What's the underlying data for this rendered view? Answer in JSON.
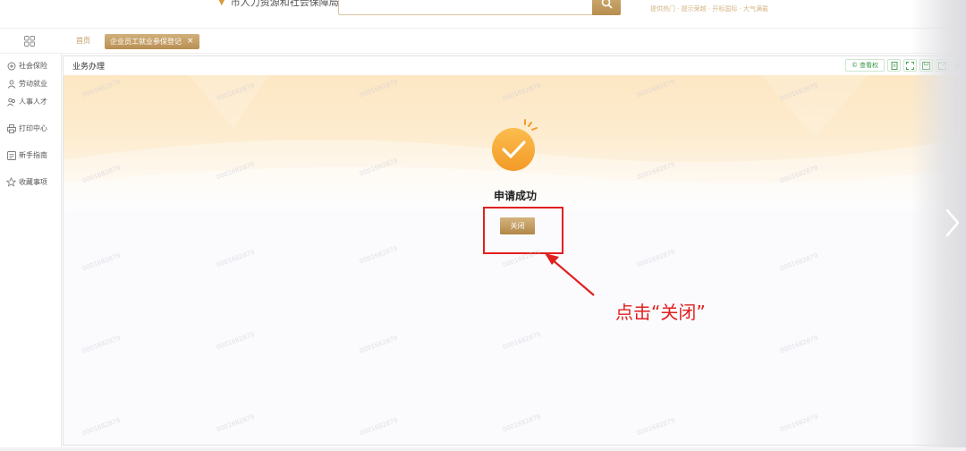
{
  "header": {
    "org_name": "市人力资源和社会保障局",
    "hot_links": "提供热门 · 提示荣越 · 开标国际 · 大气满载"
  },
  "tabs": {
    "home": "首页",
    "active": "企业员工就业参保登记",
    "close_glyph": "×"
  },
  "sidebar": {
    "items": [
      {
        "label": "社会保险",
        "icon": "social-insurance-icon"
      },
      {
        "label": "劳动就业",
        "icon": "employment-icon"
      },
      {
        "label": "人事人才",
        "icon": "talent-icon"
      },
      {
        "label": "打印中心",
        "icon": "printer-icon"
      },
      {
        "label": "新手指南",
        "icon": "guide-icon"
      },
      {
        "label": "收藏事项",
        "icon": "star-icon"
      }
    ]
  },
  "panel": {
    "title": "业务办理",
    "tools": {
      "label": "查看权",
      "icons": [
        "bookmark-icon",
        "fullscreen-icon",
        "save-icon",
        "export-icon",
        "settings-icon"
      ]
    }
  },
  "result": {
    "message": "申请成功",
    "close_label": "关闭"
  },
  "annotation": {
    "text": "点击“关闭”",
    "color": "#e02020"
  },
  "watermark": "0001682879",
  "colors": {
    "accent": "#c29a62",
    "success": "#f5a623",
    "tool_green": "#3c9a48"
  }
}
